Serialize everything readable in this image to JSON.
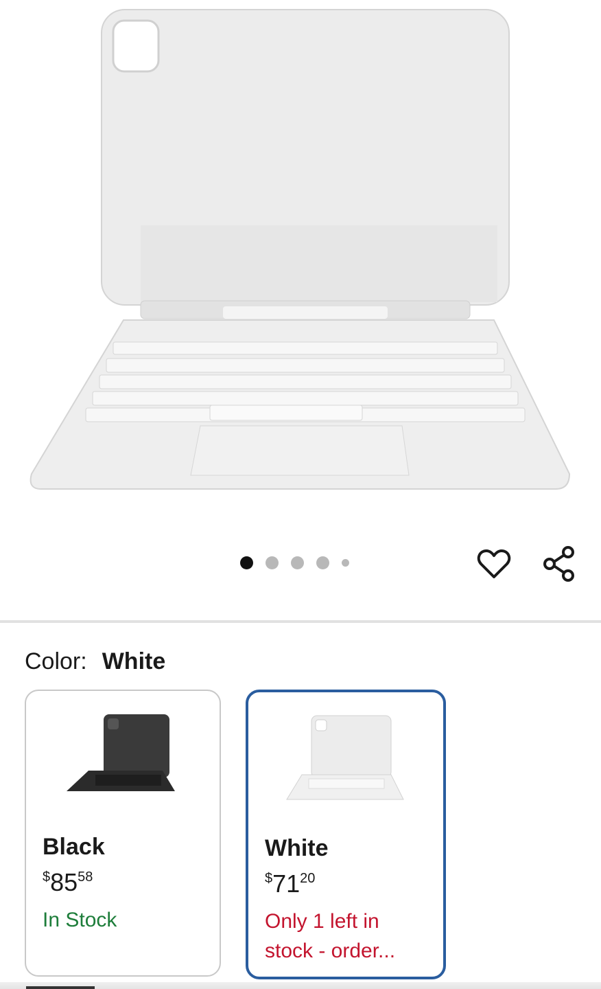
{
  "gallery": {
    "image_alt": "White Magic Keyboard folio for iPad",
    "dots": [
      true,
      false,
      false,
      false,
      false
    ],
    "favorite_icon": "heart-outline-icon",
    "share_icon": "share-icon"
  },
  "color_selector": {
    "label": "Color:",
    "value": "White"
  },
  "variants": [
    {
      "name": "Black",
      "price_currency": "$",
      "price_dollars": "85",
      "price_cents": "58",
      "stock": "In Stock",
      "stock_color": "#1d7d3a",
      "selected": false
    },
    {
      "name": "White",
      "price_currency": "$",
      "price_dollars": "71",
      "price_cents": "20",
      "stock": "Only 1 left in stock - order...",
      "stock_color": "#c3142e",
      "selected": true
    }
  ],
  "colors": {
    "selected_border": "#2a5d9f",
    "in_stock": "#1d7d3a",
    "low_stock": "#c3142e"
  }
}
